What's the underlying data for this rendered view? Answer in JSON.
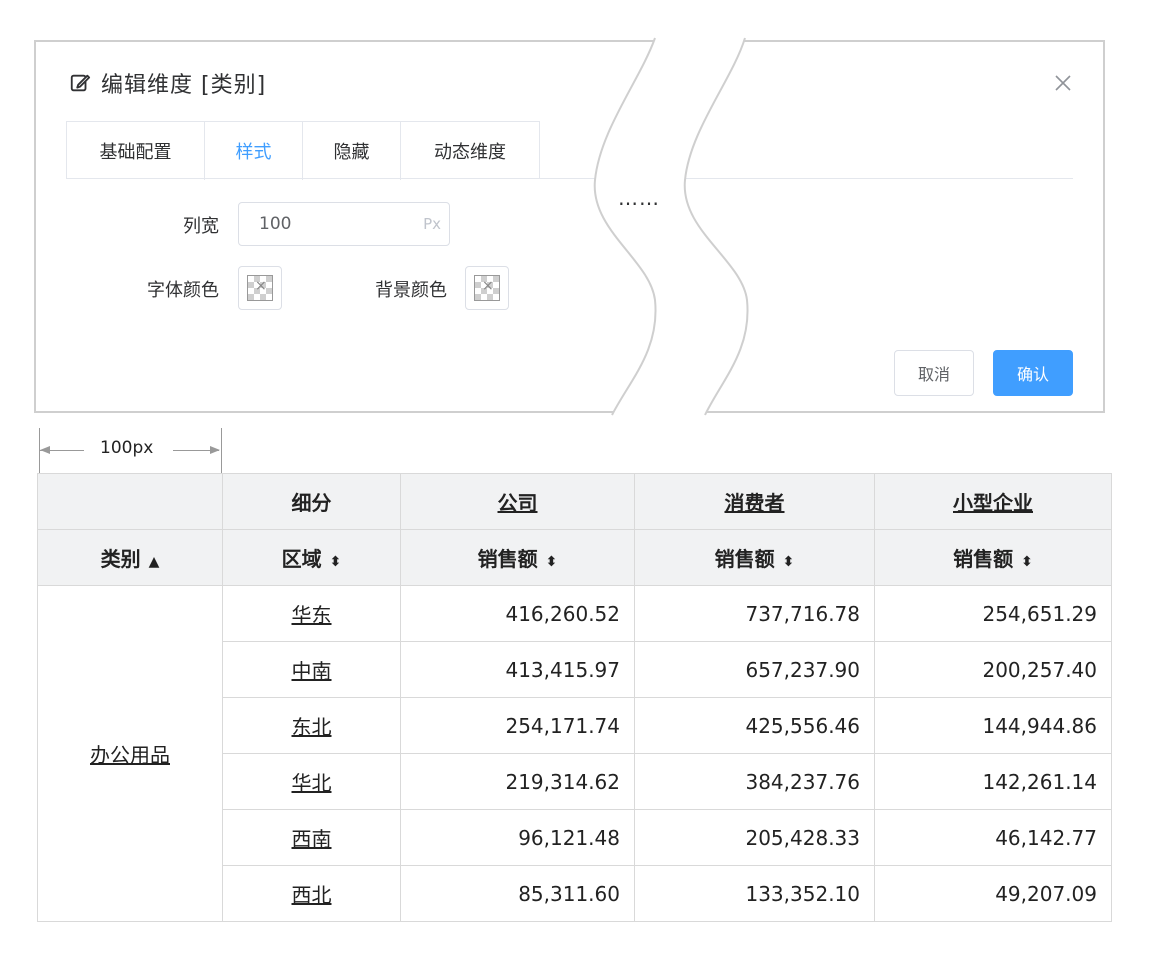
{
  "dialog": {
    "title": "编辑维度 [类别]",
    "tabs": [
      "基础配置",
      "样式",
      "隐藏",
      "动态维度"
    ],
    "active_tab": 1,
    "form": {
      "width_label": "列宽",
      "width_value": "100",
      "width_unit": "Px",
      "font_color_label": "字体颜色",
      "bg_color_label": "背景颜色"
    },
    "ellipsis": "……",
    "cancel_label": "取消",
    "ok_label": "确认",
    "accent_color": "#409eff"
  },
  "dimension_marker": {
    "label": "100px"
  },
  "table": {
    "segment_label": "细分",
    "segments": [
      "公司",
      "消费者",
      "小型企业"
    ],
    "category_header": "类别",
    "region_header": "区域",
    "measure_label": "销售额",
    "category": "办公用品",
    "rows": [
      {
        "region": "华东",
        "values": [
          "416,260.52",
          "737,716.78",
          "254,651.29"
        ]
      },
      {
        "region": "中南",
        "values": [
          "413,415.97",
          "657,237.90",
          "200,257.40"
        ]
      },
      {
        "region": "东北",
        "values": [
          "254,171.74",
          "425,556.46",
          "144,944.86"
        ]
      },
      {
        "region": "华北",
        "values": [
          "219,314.62",
          "384,237.76",
          "142,261.14"
        ]
      },
      {
        "region": "西南",
        "values": [
          "96,121.48",
          "205,428.33",
          "46,142.77"
        ]
      },
      {
        "region": "西北",
        "values": [
          "85,311.60",
          "133,352.10",
          "49,207.09"
        ]
      }
    ]
  }
}
